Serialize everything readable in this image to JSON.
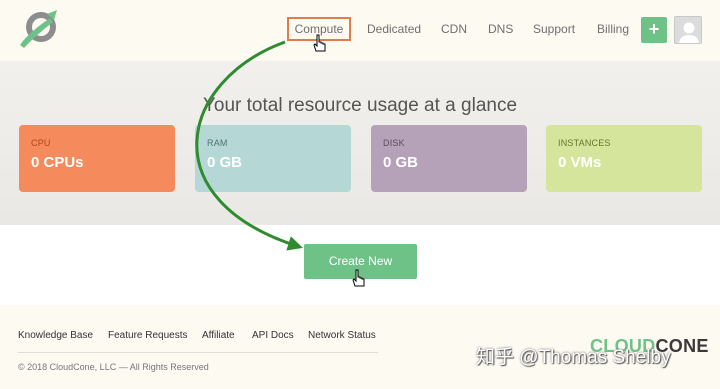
{
  "header": {
    "nav": [
      {
        "label": "Dedicated"
      },
      {
        "label": "CDN"
      },
      {
        "label": "DNS"
      },
      {
        "label": "Support"
      },
      {
        "label": "Billing"
      }
    ],
    "compute_label": "Compute",
    "plus_label": "+"
  },
  "usage": {
    "headline": "Your total resource usage at a glance",
    "cards": [
      {
        "label": "CPU",
        "value": "0 CPUs",
        "color": "#f58a5c",
        "label_color": "#b0461c"
      },
      {
        "label": "RAM",
        "value": "0 GB",
        "color": "#b5d8d7",
        "label_color": "#4f7472"
      },
      {
        "label": "DISK",
        "value": "0 GB",
        "color": "#b6a2b8",
        "label_color": "#5e4a60"
      },
      {
        "label": "INSTANCES",
        "value": "0 VMs",
        "color": "#d5e59c",
        "label_color": "#66762c"
      }
    ]
  },
  "create_button": {
    "label": "Create New"
  },
  "footer": {
    "links": [
      "Knowledge Base",
      "Feature Requests",
      "Affiliate",
      "API Docs",
      "Network Status"
    ],
    "copyright": "© 2018 CloudCone, LLC — All Rights Reserved",
    "brand_cloud": "CLOUD",
    "brand_cone": "CONE"
  },
  "watermark": "知乎 @Thomas Shelby",
  "colors": {
    "accent_green": "#6ec287",
    "highlight_orange": "#e07b4a",
    "arrow_green": "#2e8b2e"
  }
}
